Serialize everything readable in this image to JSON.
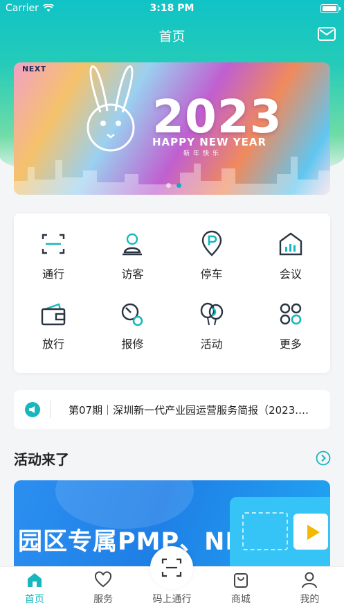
{
  "status_bar": {
    "carrier": "Carrier",
    "time": "3:18 PM"
  },
  "header": {
    "title": "首页"
  },
  "banner": {
    "logo": "NEXT",
    "year": "2023",
    "subtitle": "HAPPY NEW YEAR",
    "subtitle_cn": "新年快乐"
  },
  "grid": {
    "items": [
      {
        "label": "通行",
        "icon": "scan-icon"
      },
      {
        "label": "访客",
        "icon": "visitor-icon"
      },
      {
        "label": "停车",
        "icon": "parking-icon"
      },
      {
        "label": "会议",
        "icon": "meeting-icon"
      },
      {
        "label": "放行",
        "icon": "release-icon"
      },
      {
        "label": "报修",
        "icon": "repair-icon"
      },
      {
        "label": "活动",
        "icon": "balloon-icon"
      },
      {
        "label": "更多",
        "icon": "more-icon"
      }
    ]
  },
  "notice": {
    "text": "第07期｜深圳新一代产业园运营服务简报（2023.…"
  },
  "section": {
    "title": "活动来了"
  },
  "activity": {
    "title": "园区专属PMP、NPDP"
  },
  "tabs": [
    {
      "label": "首页",
      "icon": "home-icon",
      "active": true
    },
    {
      "label": "服务",
      "icon": "heart-icon",
      "active": false
    },
    {
      "label": "码上通行",
      "icon": "scan-icon",
      "active": false
    },
    {
      "label": "商城",
      "icon": "shop-bag-icon",
      "active": false
    },
    {
      "label": "我的",
      "icon": "profile-icon",
      "active": false
    }
  ],
  "colors": {
    "accent": "#16b7bd",
    "header": "#10c3c6"
  }
}
